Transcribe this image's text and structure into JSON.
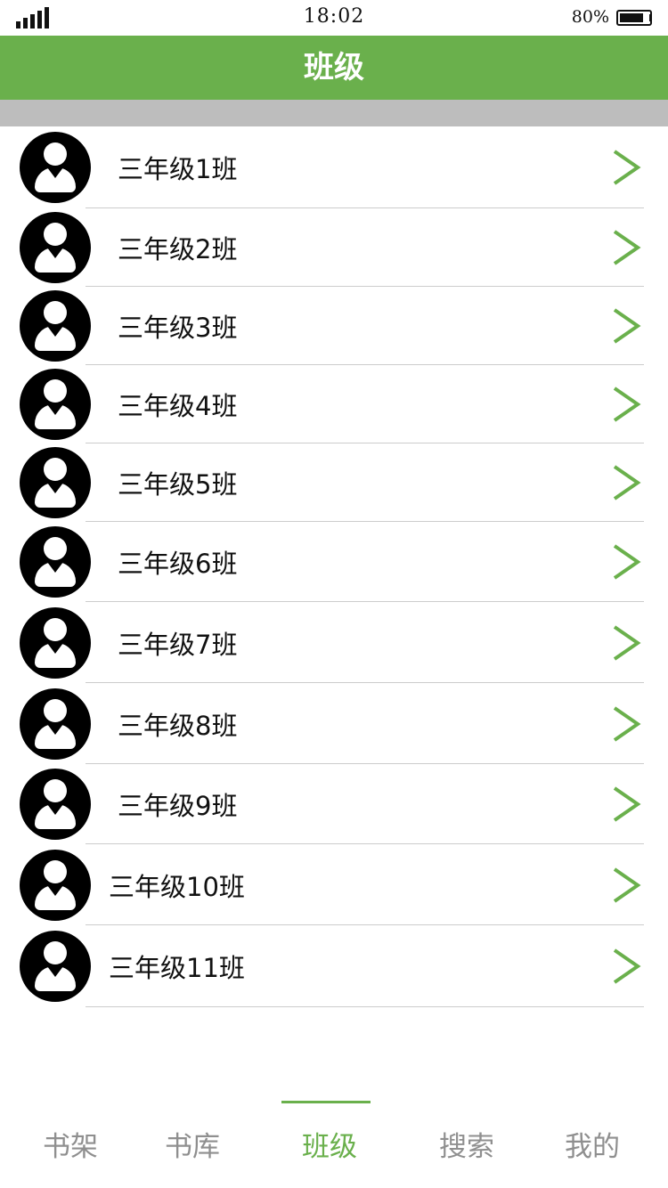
{
  "status_bar": {
    "time": "18:02",
    "battery_text": "80%",
    "battery_level": 0.8,
    "signal_icon": "signal-bars-icon",
    "battery_icon": "battery-icon"
  },
  "header": {
    "title": "班级"
  },
  "colors": {
    "accent": "#6ab04c",
    "band": "#bdbdbd",
    "tab_inactive": "#8f8f8f"
  },
  "classes": [
    {
      "name": "三年级1班"
    },
    {
      "name": "三年级2班"
    },
    {
      "name": "三年级3班"
    },
    {
      "name": "三年级4班"
    },
    {
      "name": "三年级5班"
    },
    {
      "name": "三年级6班"
    },
    {
      "name": "三年级7班"
    },
    {
      "name": "三年级8班"
    },
    {
      "name": "三年级9班"
    },
    {
      "name": "三年级10班"
    },
    {
      "name": "三年级11班"
    }
  ],
  "row_icons": {
    "avatar": "user-avatar-icon",
    "chevron": "chevron-right-icon"
  },
  "tabs": [
    {
      "label": "书架",
      "active": false
    },
    {
      "label": "书库",
      "active": false
    },
    {
      "label": "班级",
      "active": true
    },
    {
      "label": "搜索",
      "active": false
    },
    {
      "label": "我的",
      "active": false
    }
  ]
}
